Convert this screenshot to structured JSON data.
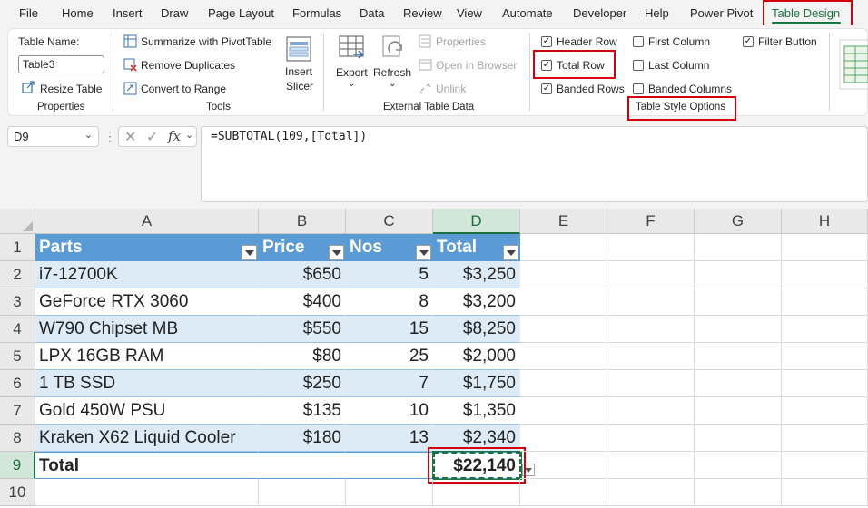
{
  "menu": {
    "tabs": [
      "File",
      "Home",
      "Insert",
      "Draw",
      "Page Layout",
      "Formulas",
      "Data",
      "Review",
      "View",
      "Automate",
      "Developer",
      "Help",
      "Power Pivot",
      "Table Design"
    ],
    "active_tab": "Table Design"
  },
  "ribbon": {
    "properties": {
      "table_name_label": "Table Name:",
      "table_name_value": "Table3",
      "resize_table": "Resize Table",
      "group_label": "Properties"
    },
    "tools": {
      "summarize_pivot": "Summarize with PivotTable",
      "remove_duplicates": "Remove Duplicates",
      "convert_to_range": "Convert to Range",
      "insert_slicer_line1": "Insert",
      "insert_slicer_line2": "Slicer",
      "group_label": "Tools"
    },
    "external_table_data": {
      "export": "Export",
      "refresh": "Refresh",
      "properties": "Properties",
      "open_in_browser": "Open in Browser",
      "unlink": "Unlink",
      "group_label": "External Table Data"
    },
    "table_style_options": {
      "header_row": "Header Row",
      "total_row": "Total Row",
      "banded_rows": "Banded Rows",
      "first_column": "First Column",
      "last_column": "Last Column",
      "banded_columns": "Banded Columns",
      "filter_button": "Filter Button",
      "checked": {
        "header_row": true,
        "total_row": true,
        "banded_rows": true,
        "first_column": false,
        "last_column": false,
        "banded_columns": false,
        "filter_button": true
      },
      "check_glyph": "✓",
      "group_label": "Table Style Options"
    }
  },
  "formula_bar": {
    "name_box": "D9",
    "formula": "=SUBTOTAL(109,[Total])"
  },
  "sheet": {
    "columns": [
      "A",
      "B",
      "C",
      "D",
      "E",
      "F",
      "G",
      "H"
    ],
    "rows": [
      "1",
      "2",
      "3",
      "4",
      "5",
      "6",
      "7",
      "8",
      "9",
      "10"
    ],
    "selected_cell": "D9",
    "table": {
      "headers": [
        "Parts",
        "Price",
        "Nos",
        "Total"
      ],
      "rows": [
        [
          "i7-12700K",
          "$650",
          "5",
          "$3,250"
        ],
        [
          "GeForce RTX 3060",
          "$400",
          "8",
          "$3,200"
        ],
        [
          "W790 Chipset MB",
          "$550",
          "15",
          "$8,250"
        ],
        [
          "LPX 16GB RAM",
          "$80",
          "25",
          "$2,000"
        ],
        [
          "1 TB SSD",
          "$250",
          "7",
          "$1,750"
        ],
        [
          "Gold 450W PSU",
          "$135",
          "10",
          "$1,350"
        ],
        [
          "Kraken X62 Liquid Cooler",
          "$180",
          "13",
          "$2,340"
        ]
      ],
      "total_row": [
        "Total",
        "",
        "",
        "$22,140"
      ]
    }
  },
  "colors": {
    "accent_green": "#1e7145",
    "highlight_red": "#d4000d",
    "table_header_blue": "#5b9bd5",
    "band_blue": "#ddebf7"
  }
}
